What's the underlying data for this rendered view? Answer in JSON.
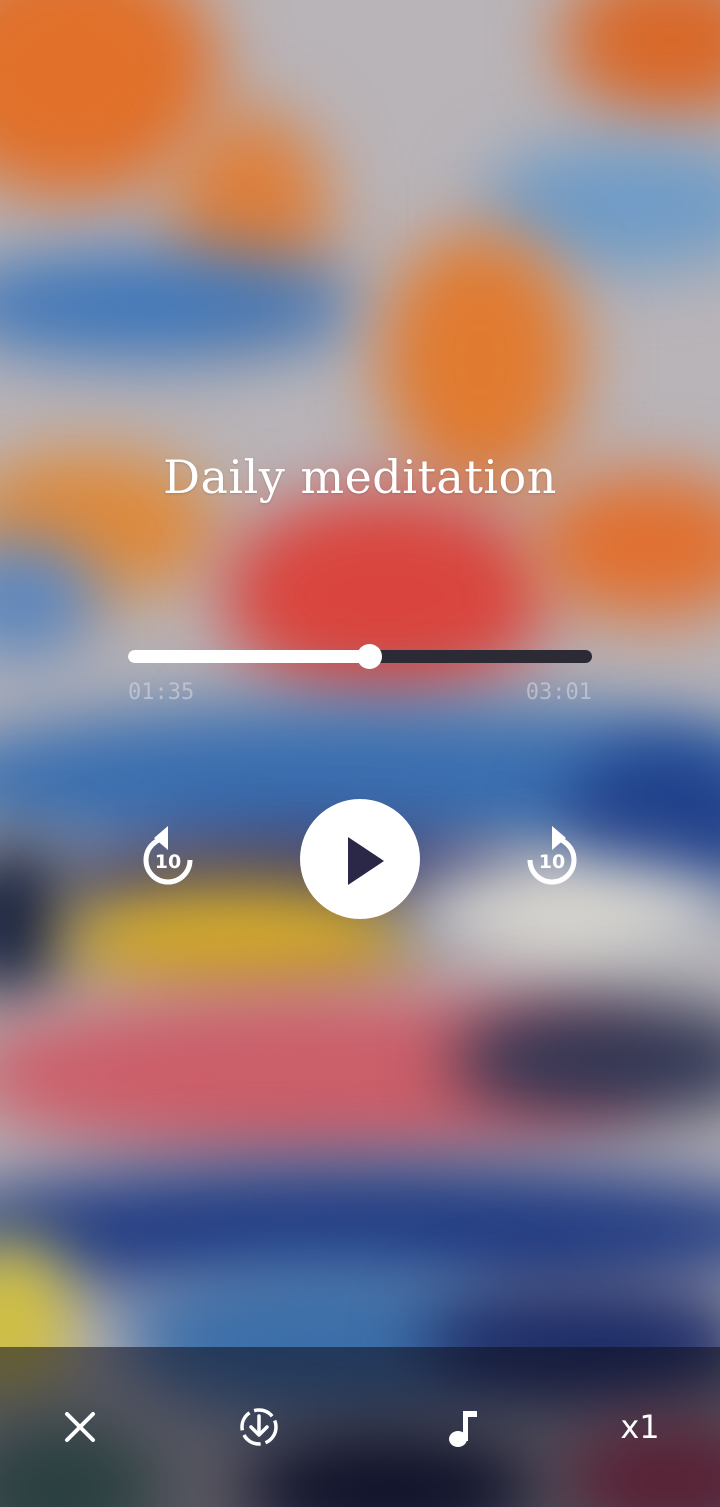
{
  "player": {
    "title": "Daily meditation",
    "elapsed": "01:35",
    "duration": "03:01",
    "progress_fraction": 0.52,
    "skip_back_seconds": "10",
    "skip_forward_seconds": "10"
  },
  "toolbar": {
    "speed_label": "x1",
    "icons": [
      "close-icon",
      "download-icon",
      "music-note-icon",
      "speed"
    ]
  },
  "colors": {
    "track_background": "#2b2a35",
    "track_fill": "#ffffff",
    "play_icon": "#2a2846"
  }
}
